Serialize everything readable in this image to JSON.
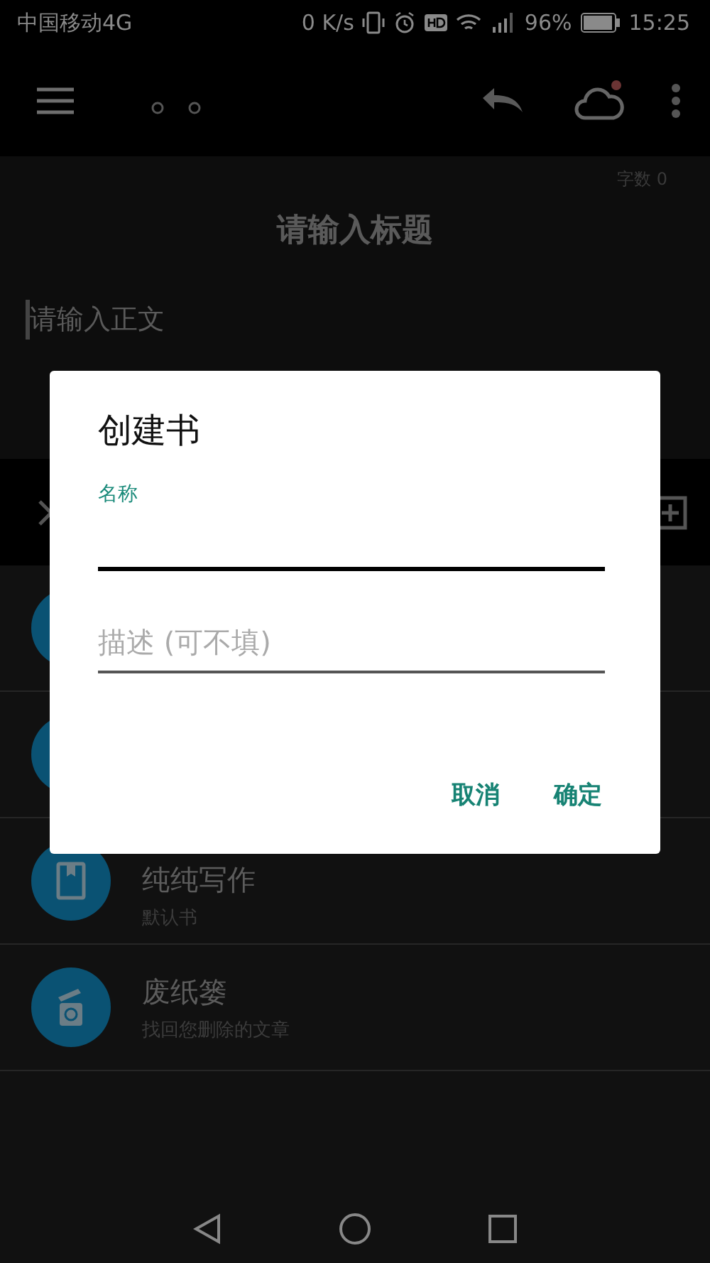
{
  "status_bar": {
    "carrier": "中国移动4G",
    "speed": "0 K/s",
    "battery": "96%",
    "time": "15:25"
  },
  "toolbar": {
    "cloud_badge": true
  },
  "editor": {
    "word_count": "字数 0",
    "title_placeholder": "请输入标题",
    "body_placeholder": "请输入正文"
  },
  "books": [
    {
      "kind": "book"
    },
    {
      "kind": "book"
    },
    {
      "kind": "book",
      "name": "纯纯写作",
      "description": "默认书"
    },
    {
      "kind": "trash",
      "name": "废纸篓",
      "description": "找回您删除的文章"
    }
  ],
  "dialog": {
    "title": "创建书",
    "fields": [
      {
        "label": "名称",
        "focused": true
      },
      {
        "placeholder": "描述 (可不填)",
        "focused": false
      }
    ],
    "buttons": [
      "取消",
      "确定"
    ]
  }
}
